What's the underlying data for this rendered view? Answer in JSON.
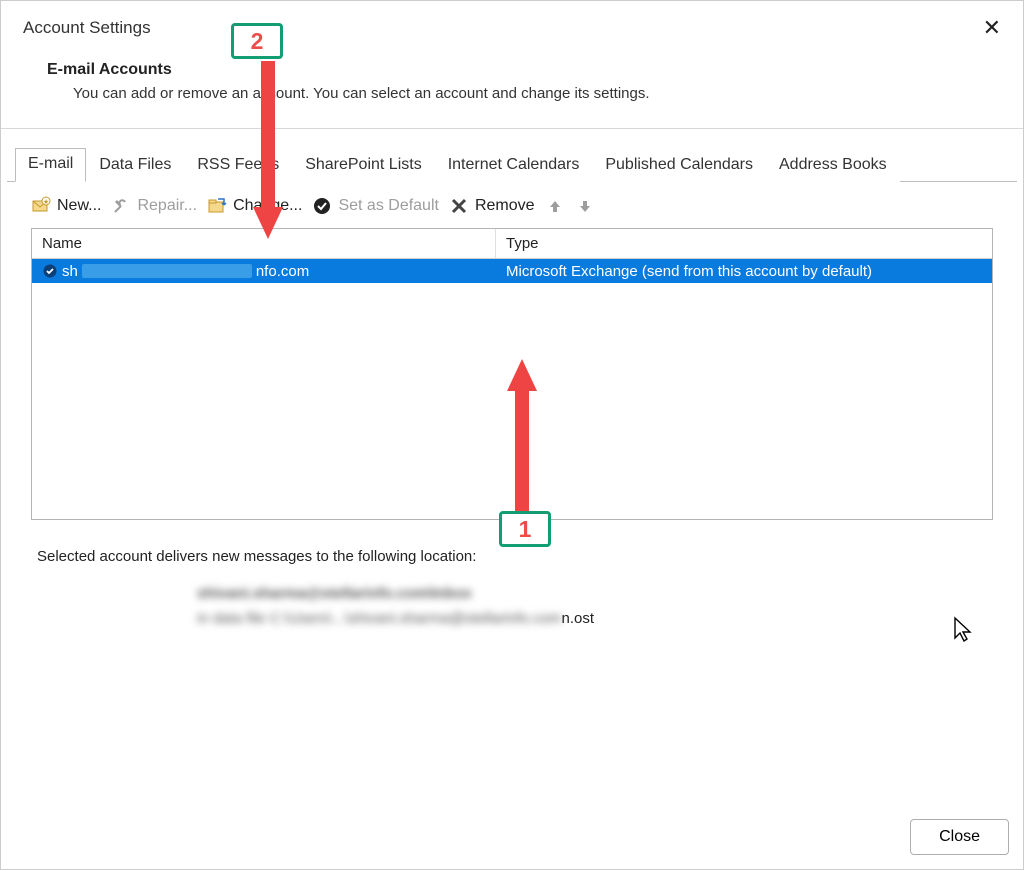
{
  "window": {
    "title": "Account Settings",
    "close_glyph": "✕"
  },
  "header": {
    "heading": "E-mail Accounts",
    "description": "You can add or remove an account. You can select an account and change its settings."
  },
  "tabs": [
    {
      "label": "E-mail",
      "active": true
    },
    {
      "label": "Data Files",
      "active": false
    },
    {
      "label": "RSS Feeds",
      "active": false
    },
    {
      "label": "SharePoint Lists",
      "active": false
    },
    {
      "label": "Internet Calendars",
      "active": false
    },
    {
      "label": "Published Calendars",
      "active": false
    },
    {
      "label": "Address Books",
      "active": false
    }
  ],
  "toolbar": {
    "new_label": "New...",
    "repair_label": "Repair...",
    "change_label": "Change...",
    "set_default_label": "Set as Default",
    "remove_label": "Remove"
  },
  "columns": {
    "name": "Name",
    "type": "Type"
  },
  "accounts": [
    {
      "name_prefix": "sh",
      "name_suffix": "nfo.com",
      "type": "Microsoft Exchange (send from this account by default)",
      "selected": true,
      "is_default": true
    }
  ],
  "location": {
    "intro": "Selected account delivers new messages to the following location:",
    "line1_blurred": "shivani.sharma@stellarinfo.com\\Inbox",
    "line2_prefix_blurred": "in data file C:\\Users\\...\\shivani.sharma@stellarinfo.com",
    "line2_suffix": "n.ost"
  },
  "footer": {
    "close_label": "Close"
  },
  "annotations": {
    "callout1": "1",
    "callout2": "2"
  }
}
